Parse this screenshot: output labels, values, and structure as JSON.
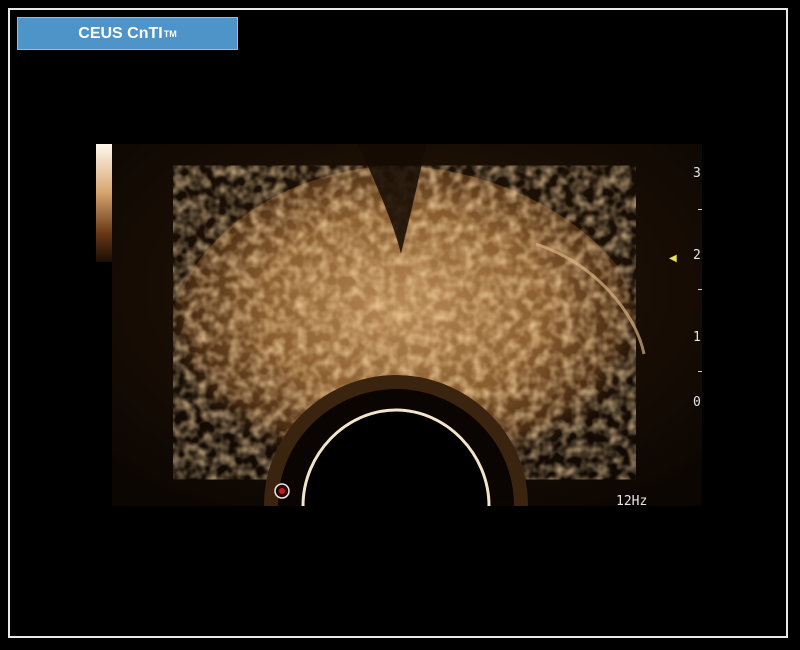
{
  "mode": {
    "label": "CEUS CnTI",
    "tm": "TM"
  },
  "depth_scale": {
    "labels": [
      "3",
      "2",
      "1",
      "0"
    ]
  },
  "frame_rate": "12Hz"
}
